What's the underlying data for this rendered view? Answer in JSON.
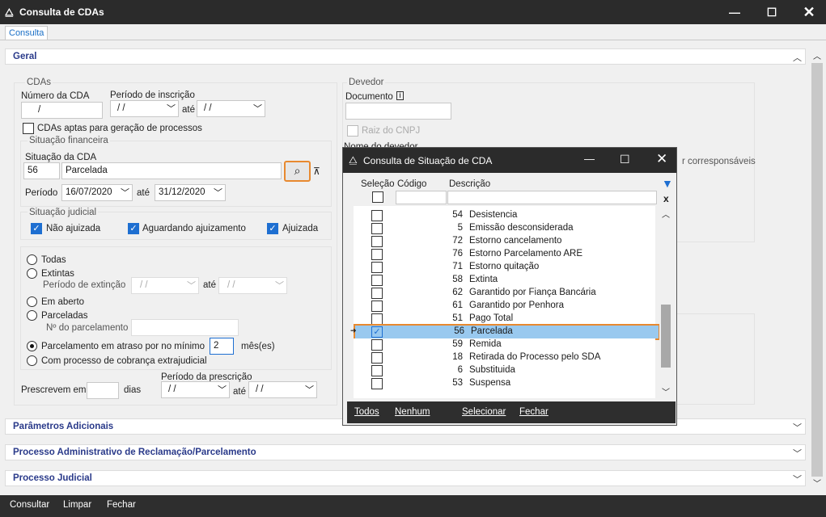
{
  "window": {
    "title": "Consulta de CDAs"
  },
  "tab": {
    "label": "Consulta"
  },
  "sections": {
    "geral": "Geral",
    "parametros": "Parâmetros Adicionais",
    "processo_adm": "Processo Administrativo de Reclamação/Parcelamento",
    "processo_judicial": "Processo Judicial"
  },
  "cdas": {
    "group_label": "CDAs",
    "numero_label": "Número da CDA",
    "numero_value": "/",
    "periodo_label": "Período de inscrição",
    "periodo_from": "/ /",
    "ate": "até",
    "periodo_to": "/ /",
    "aptas_label": "CDAs aptas para geração de processos"
  },
  "financeira": {
    "group_label": "Situação financeira",
    "situacao_label": "Situação da CDA",
    "codigo": "56",
    "descricao": "Parcelada",
    "periodo_label": "Período",
    "from": "16/07/2020",
    "ate": "até",
    "to": "31/12/2020"
  },
  "judicial": {
    "group_label": "Situação judicial",
    "nao_ajuizada": "Não ajuizada",
    "aguardando": "Aguardando ajuizamento",
    "ajuizada": "Ajuizada"
  },
  "radios": {
    "todas": "Todas",
    "extintas": "Extintas",
    "periodo_extincao": "Período de extinção",
    "ext_from": "/ /",
    "ate": "até",
    "ext_to": "/ /",
    "em_aberto": "Em aberto",
    "parceladas": "Parceladas",
    "n_parcelamento": "Nº do parcelamento",
    "atraso": "Parcelamento em atraso por no mínimo",
    "atraso_value": "2",
    "meses": "mês(es)",
    "cobranca": "Com processo de cobrança extrajudicial"
  },
  "prescricao": {
    "periodo_label": "Período da prescrição",
    "prescrevem": "Prescrevem em",
    "dias": "dias",
    "from": "/ /",
    "ate": "até",
    "to": "/ /"
  },
  "devedor": {
    "group_label": "Devedor",
    "documento": "Documento",
    "raiz": "Raiz do CNPJ",
    "nome": "Nome do devedor",
    "corresp": "r corresponsáveis"
  },
  "modal": {
    "title": "Consulta de Situação de CDA",
    "headers": {
      "selecao": "Seleção",
      "codigo": "Código",
      "descricao": "Descrição"
    },
    "rows": [
      {
        "code": "54",
        "desc": "Desistencia",
        "checked": false
      },
      {
        "code": "5",
        "desc": "Emissão desconsiderada",
        "checked": false
      },
      {
        "code": "72",
        "desc": "Estorno cancelamento",
        "checked": false
      },
      {
        "code": "76",
        "desc": "Estorno Parcelamento ARE",
        "checked": false
      },
      {
        "code": "71",
        "desc": "Estorno quitação",
        "checked": false
      },
      {
        "code": "58",
        "desc": "Extinta",
        "checked": false
      },
      {
        "code": "62",
        "desc": "Garantido por Fiança Bancária",
        "checked": false
      },
      {
        "code": "61",
        "desc": "Garantido por Penhora",
        "checked": false
      },
      {
        "code": "51",
        "desc": "Pago Total",
        "checked": false
      },
      {
        "code": "56",
        "desc": "Parcelada",
        "checked": true
      },
      {
        "code": "59",
        "desc": "Remida",
        "checked": false
      },
      {
        "code": "18",
        "desc": "Retirada do Processo pelo SDA",
        "checked": false
      },
      {
        "code": "6",
        "desc": "Substituida",
        "checked": false
      },
      {
        "code": "53",
        "desc": "Suspensa",
        "checked": false
      }
    ],
    "footer": {
      "todos": "Todos",
      "nenhum": "Nenhum",
      "selecionar": "Selecionar",
      "fechar": "Fechar"
    }
  },
  "bottom": {
    "consultar": "Consultar",
    "limpar": "Limpar",
    "fechar": "Fechar"
  },
  "colors": {
    "accent": "#1e6fd1",
    "highlight": "#e8892f",
    "selected_row": "#99c9ef"
  }
}
